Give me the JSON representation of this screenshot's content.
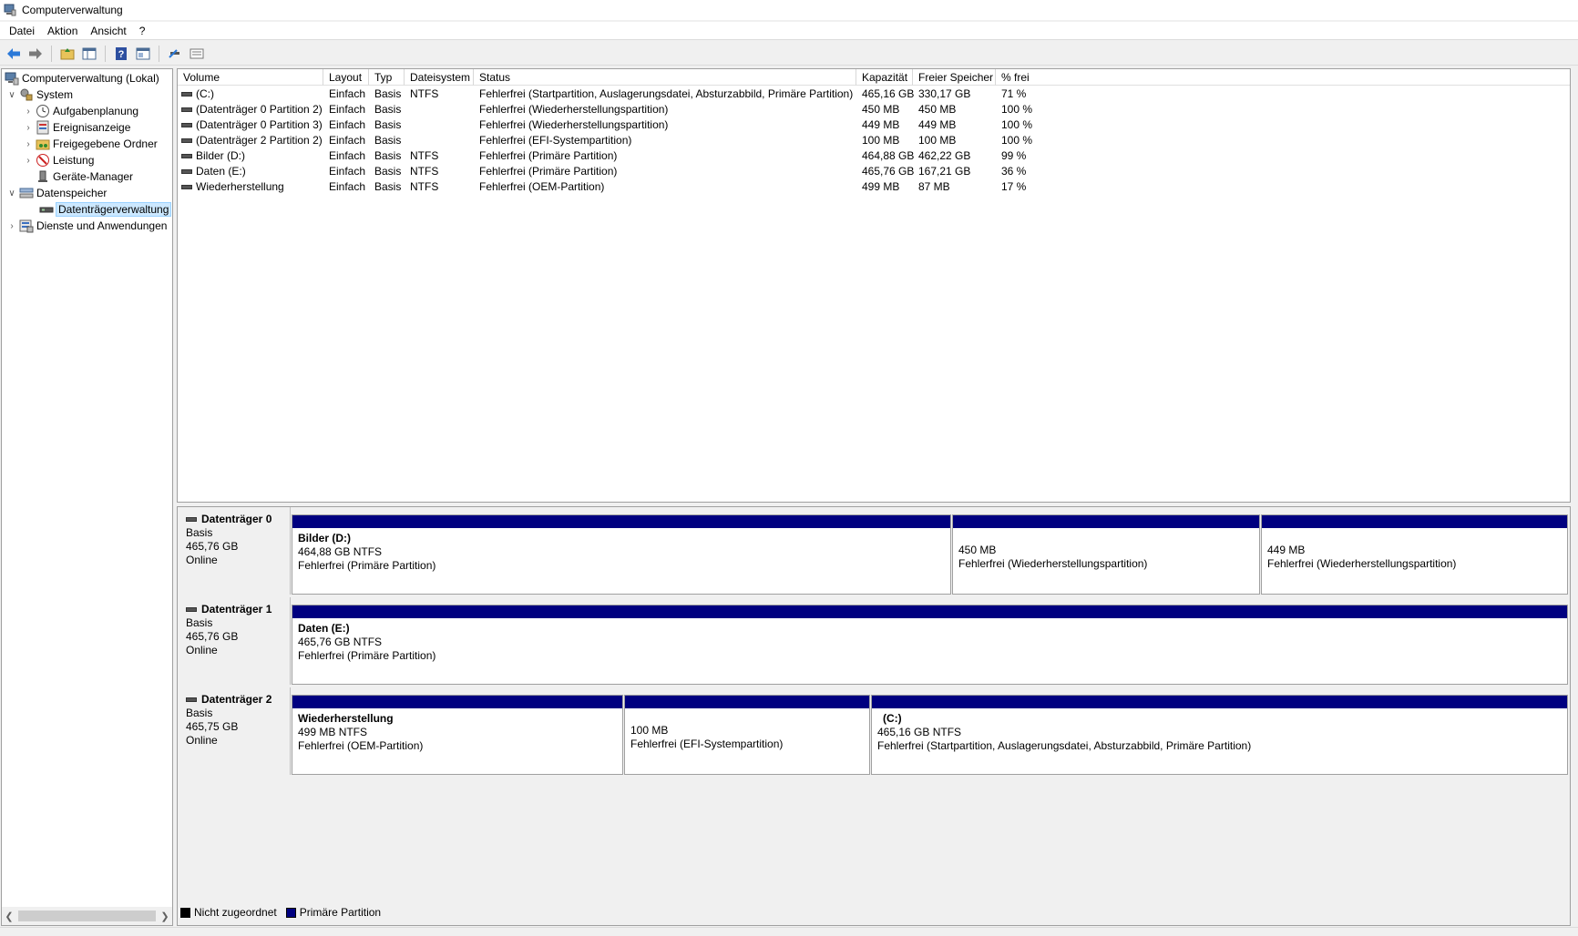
{
  "window": {
    "title": "Computerverwaltung"
  },
  "menu": [
    "Datei",
    "Aktion",
    "Ansicht",
    "?"
  ],
  "toolbar": {
    "icons": [
      "back-arrow-icon",
      "forward-arrow-icon",
      "up-folder-icon",
      "show-hide-tree-icon",
      "help-icon",
      "properties-icon",
      "connect-icon",
      "view-icon"
    ]
  },
  "tree": {
    "root": "Computerverwaltung (Lokal)",
    "system": "System",
    "aufgaben": "Aufgabenplanung",
    "ereignis": "Ereignisanzeige",
    "freigegeben": "Freigegebene Ordner",
    "leistung": "Leistung",
    "geraete": "Geräte-Manager",
    "datenspeicher": "Datenspeicher",
    "datentraeger": "Datenträgerverwaltung",
    "dienste": "Dienste und Anwendungen"
  },
  "volumes": {
    "headers": [
      "Volume",
      "Layout",
      "Typ",
      "Dateisystem",
      "Status",
      "Kapazität",
      "Freier Speicher",
      "% frei"
    ],
    "rows": [
      [
        "(C:)",
        "Einfach",
        "Basis",
        "NTFS",
        "Fehlerfrei (Startpartition, Auslagerungsdatei, Absturzabbild, Primäre Partition)",
        "465,16 GB",
        "330,17 GB",
        "71 %"
      ],
      [
        "(Datenträger 0 Partition 2)",
        "Einfach",
        "Basis",
        "",
        "Fehlerfrei (Wiederherstellungspartition)",
        "450 MB",
        "450 MB",
        "100 %"
      ],
      [
        "(Datenträger 0 Partition 3)",
        "Einfach",
        "Basis",
        "",
        "Fehlerfrei (Wiederherstellungspartition)",
        "449 MB",
        "449 MB",
        "100 %"
      ],
      [
        "(Datenträger 2 Partition 2)",
        "Einfach",
        "Basis",
        "",
        "Fehlerfrei (EFI-Systempartition)",
        "100 MB",
        "100 MB",
        "100 %"
      ],
      [
        "Bilder (D:)",
        "Einfach",
        "Basis",
        "NTFS",
        "Fehlerfrei (Primäre Partition)",
        "464,88 GB",
        "462,22 GB",
        "99 %"
      ],
      [
        "Daten (E:)",
        "Einfach",
        "Basis",
        "NTFS",
        "Fehlerfrei (Primäre Partition)",
        "465,76 GB",
        "167,21 GB",
        "36 %"
      ],
      [
        "Wiederherstellung",
        "Einfach",
        "Basis",
        "NTFS",
        "Fehlerfrei (OEM-Partition)",
        "499 MB",
        "87 MB",
        "17 %"
      ]
    ]
  },
  "disks": [
    {
      "name": "Datenträger 0",
      "type": "Basis",
      "size": "465,76 GB",
      "state": "Online",
      "partitions": [
        {
          "name": "Bilder  (D:)",
          "size": "464,88 GB NTFS",
          "status": "Fehlerfrei (Primäre Partition)"
        },
        {
          "name": "",
          "size": "450 MB",
          "status": "Fehlerfrei (Wiederherstellungspartition)"
        },
        {
          "name": "",
          "size": "449 MB",
          "status": "Fehlerfrei (Wiederherstellungspartition)"
        }
      ]
    },
    {
      "name": "Datenträger 1",
      "type": "Basis",
      "size": "465,76 GB",
      "state": "Online",
      "partitions": [
        {
          "name": "Daten  (E:)",
          "size": "465,76 GB NTFS",
          "status": "Fehlerfrei (Primäre Partition)"
        }
      ]
    },
    {
      "name": "Datenträger 2",
      "type": "Basis",
      "size": "465,75 GB",
      "state": "Online",
      "partitions": [
        {
          "name": "Wiederherstellung",
          "size": "499 MB NTFS",
          "status": "Fehlerfrei (OEM-Partition)"
        },
        {
          "name": "",
          "size": "100 MB",
          "status": "Fehlerfrei (EFI-Systempartition)"
        },
        {
          "name": "(C:)",
          "size": "465,16 GB NTFS",
          "status": "Fehlerfrei (Startpartition, Auslagerungsdatei, Absturzabbild, Primäre Partition)"
        }
      ]
    }
  ],
  "legend": {
    "unallocated": "Nicht zugeordnet",
    "primary": "Primäre Partition",
    "unallocated_color": "#000000",
    "primary_color": "#000080"
  }
}
